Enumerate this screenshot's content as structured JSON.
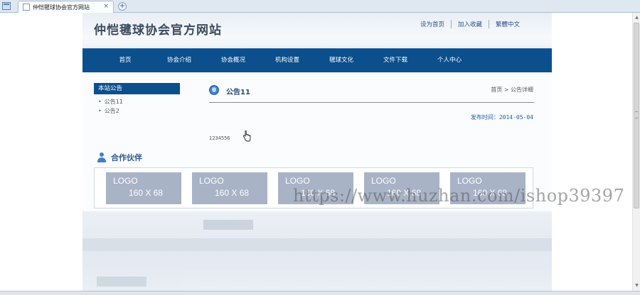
{
  "browser": {
    "tab_title": "仲恺毽球协会官方网站",
    "close_glyph": "×",
    "newtab_glyph": "+"
  },
  "header": {
    "site_title": "仲恺毽球协会官方网站",
    "top_links": [
      "设为首页",
      "加入收藏",
      "繁體中文"
    ]
  },
  "nav": {
    "items": [
      "首页",
      "协会介绍",
      "协会概况",
      "机构设置",
      "毽球文化",
      "文件下载",
      "个人中心"
    ]
  },
  "sidebar": {
    "title": "本站公告",
    "items": [
      "公告11",
      "公告2"
    ]
  },
  "article": {
    "title": "公告11",
    "breadcrumb": "首页 > 公告详细",
    "publish_time": "发布时间：2014-05-04",
    "body": "1234556"
  },
  "partners": {
    "title": "合作伙伴",
    "logos": [
      {
        "text": "LOGO",
        "size": "160 X 68"
      },
      {
        "text": "LOGO",
        "size": "160 X 68"
      },
      {
        "text": "LOGO",
        "size": "160 X 68"
      },
      {
        "text": "LOGO",
        "size": "160 X 68"
      },
      {
        "text": "LOGO",
        "size": "160 X 68"
      }
    ]
  },
  "watermark": "https://www.huzhan.com/ishop39397",
  "colors": {
    "nav_bg": "#0b4f8c",
    "link": "#2a4f8a",
    "logo_bg": "#a8b3c6"
  }
}
